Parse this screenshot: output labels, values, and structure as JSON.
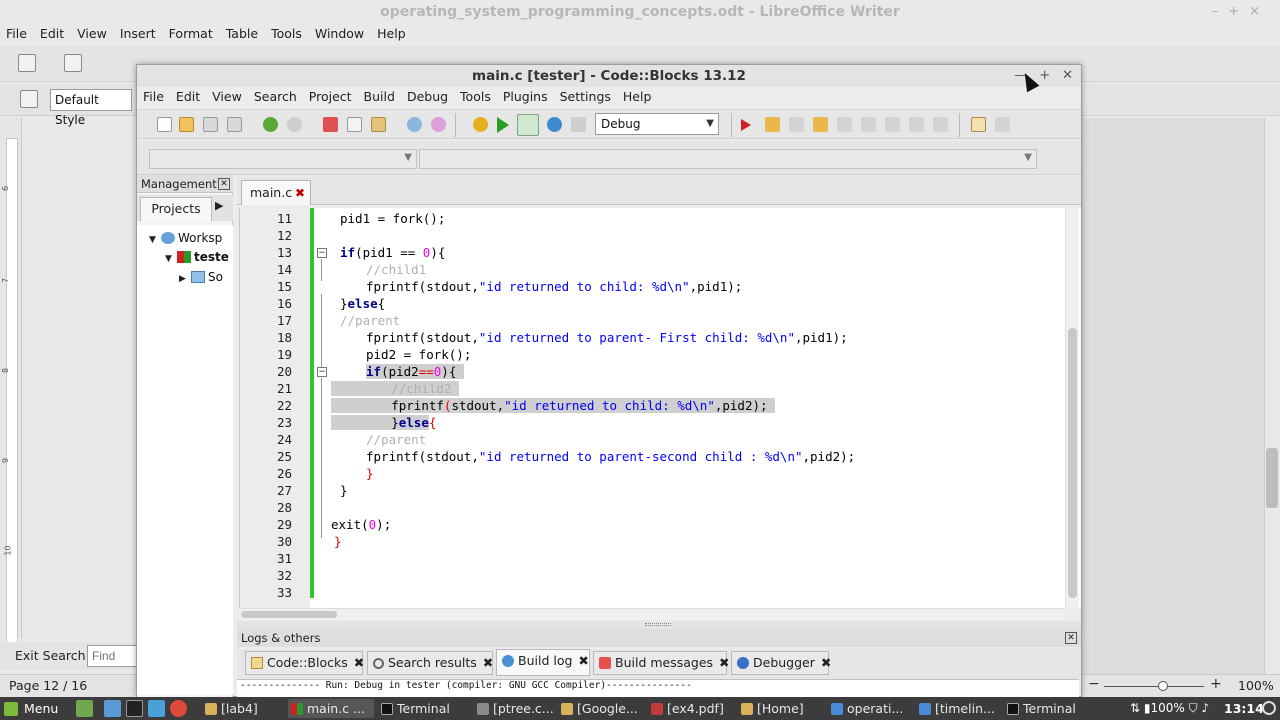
{
  "libreoffice": {
    "title": "operating_system_programming_concepts.odt - LibreOffice Writer",
    "menu": [
      "File",
      "Edit",
      "View",
      "Insert",
      "Format",
      "Table",
      "Tools",
      "Window",
      "Help"
    ],
    "paragraph_style": "Default Style",
    "find_label": "Exit Search",
    "find_placeholder": "Find",
    "page_status": "Page 12 / 16",
    "zoom": "100%",
    "ruler_ticks": [
      "6",
      "7",
      "8",
      "9",
      "10"
    ]
  },
  "codeblocks": {
    "title": "main.c [tester] - Code::Blocks 13.12",
    "menu": [
      "File",
      "Edit",
      "View",
      "Search",
      "Project",
      "Build",
      "Debug",
      "Tools",
      "Plugins",
      "Settings",
      "Help"
    ],
    "build_target": "Debug",
    "management": {
      "title": "Management",
      "tab_projects": "Projects",
      "tree": [
        "Worksp",
        "teste",
        "So"
      ]
    },
    "editor_tab": "main.c",
    "code_lines": [
      {
        "n": "11"
      },
      {
        "n": "12"
      },
      {
        "n": "13"
      },
      {
        "n": "14"
      },
      {
        "n": "15"
      },
      {
        "n": "16"
      },
      {
        "n": "17"
      },
      {
        "n": "18"
      },
      {
        "n": "19"
      },
      {
        "n": "20"
      },
      {
        "n": "21"
      },
      {
        "n": "22"
      },
      {
        "n": "23"
      },
      {
        "n": "24"
      },
      {
        "n": "25"
      },
      {
        "n": "26"
      },
      {
        "n": "27"
      },
      {
        "n": "28"
      },
      {
        "n": "29"
      },
      {
        "n": "30"
      },
      {
        "n": "31"
      },
      {
        "n": "32"
      },
      {
        "n": "33"
      }
    ],
    "code": {
      "l11": "pid1 = fork();",
      "l13a": "if",
      "l13b": "(pid1 == ",
      "l13c": "0",
      "l13d": "){",
      "l14": "//child1",
      "l15a": "fprintf(stdout,",
      "l15b": "\"id returned to child: %d\\n\"",
      "l15c": ",pid1);",
      "l16a": "}",
      "l16b": "else",
      "l16c": "{",
      "l17": "//parent",
      "l18a": "fprintf(stdout,",
      "l18b": "\"id returned to parent- First child: %d\\n\"",
      "l18c": ",pid1);",
      "l19": "pid2 = fork();",
      "l20a": "if",
      "l20b": "(pid2",
      "l20c": "==",
      "l20d": "0",
      "l20e": "){",
      "l21": "//child2",
      "l22a": "fprintf",
      "l22b": "(",
      "l22c": "stdout,",
      "l22d": "\"id returned to child: %d\\n\"",
      "l22e": ",pid2);",
      "l23a": "}",
      "l23b": "else",
      "l23c": "{",
      "l24": "//parent",
      "l25a": "fprintf(stdout,",
      "l25b": "\"id returned to parent-second child : %d\\n\"",
      "l25c": ",pid2);",
      "l26": "}",
      "l27": "}",
      "l29a": "exit(",
      "l29b": "0",
      "l29c": ");",
      "l30": "}"
    },
    "logs": {
      "title": "Logs & others",
      "tabs": [
        "Code::Blocks",
        "Search results",
        "Build log",
        "Build messages",
        "Debugger"
      ],
      "active_tab": "Build log",
      "line": "-------------- Run: Debug in tester (compiler: GNU GCC Compiler)---------------"
    }
  },
  "taskbar": {
    "menu": "Menu",
    "tasks": [
      "[lab4]",
      "main.c ...",
      "Terminal",
      "[ptree.c...",
      "[Google...",
      "[ex4.pdf]",
      "[Home]",
      "operati...",
      "[timelin...",
      "Terminal"
    ],
    "battery": "100%",
    "clock": "13:14"
  },
  "colors": {
    "change_bar": "#2dc72d",
    "keyword": "#00008b",
    "string": "#0000ff",
    "number": "#f000f0",
    "comment": "#b0b0b0",
    "taskbar": "#3c3c3c"
  }
}
